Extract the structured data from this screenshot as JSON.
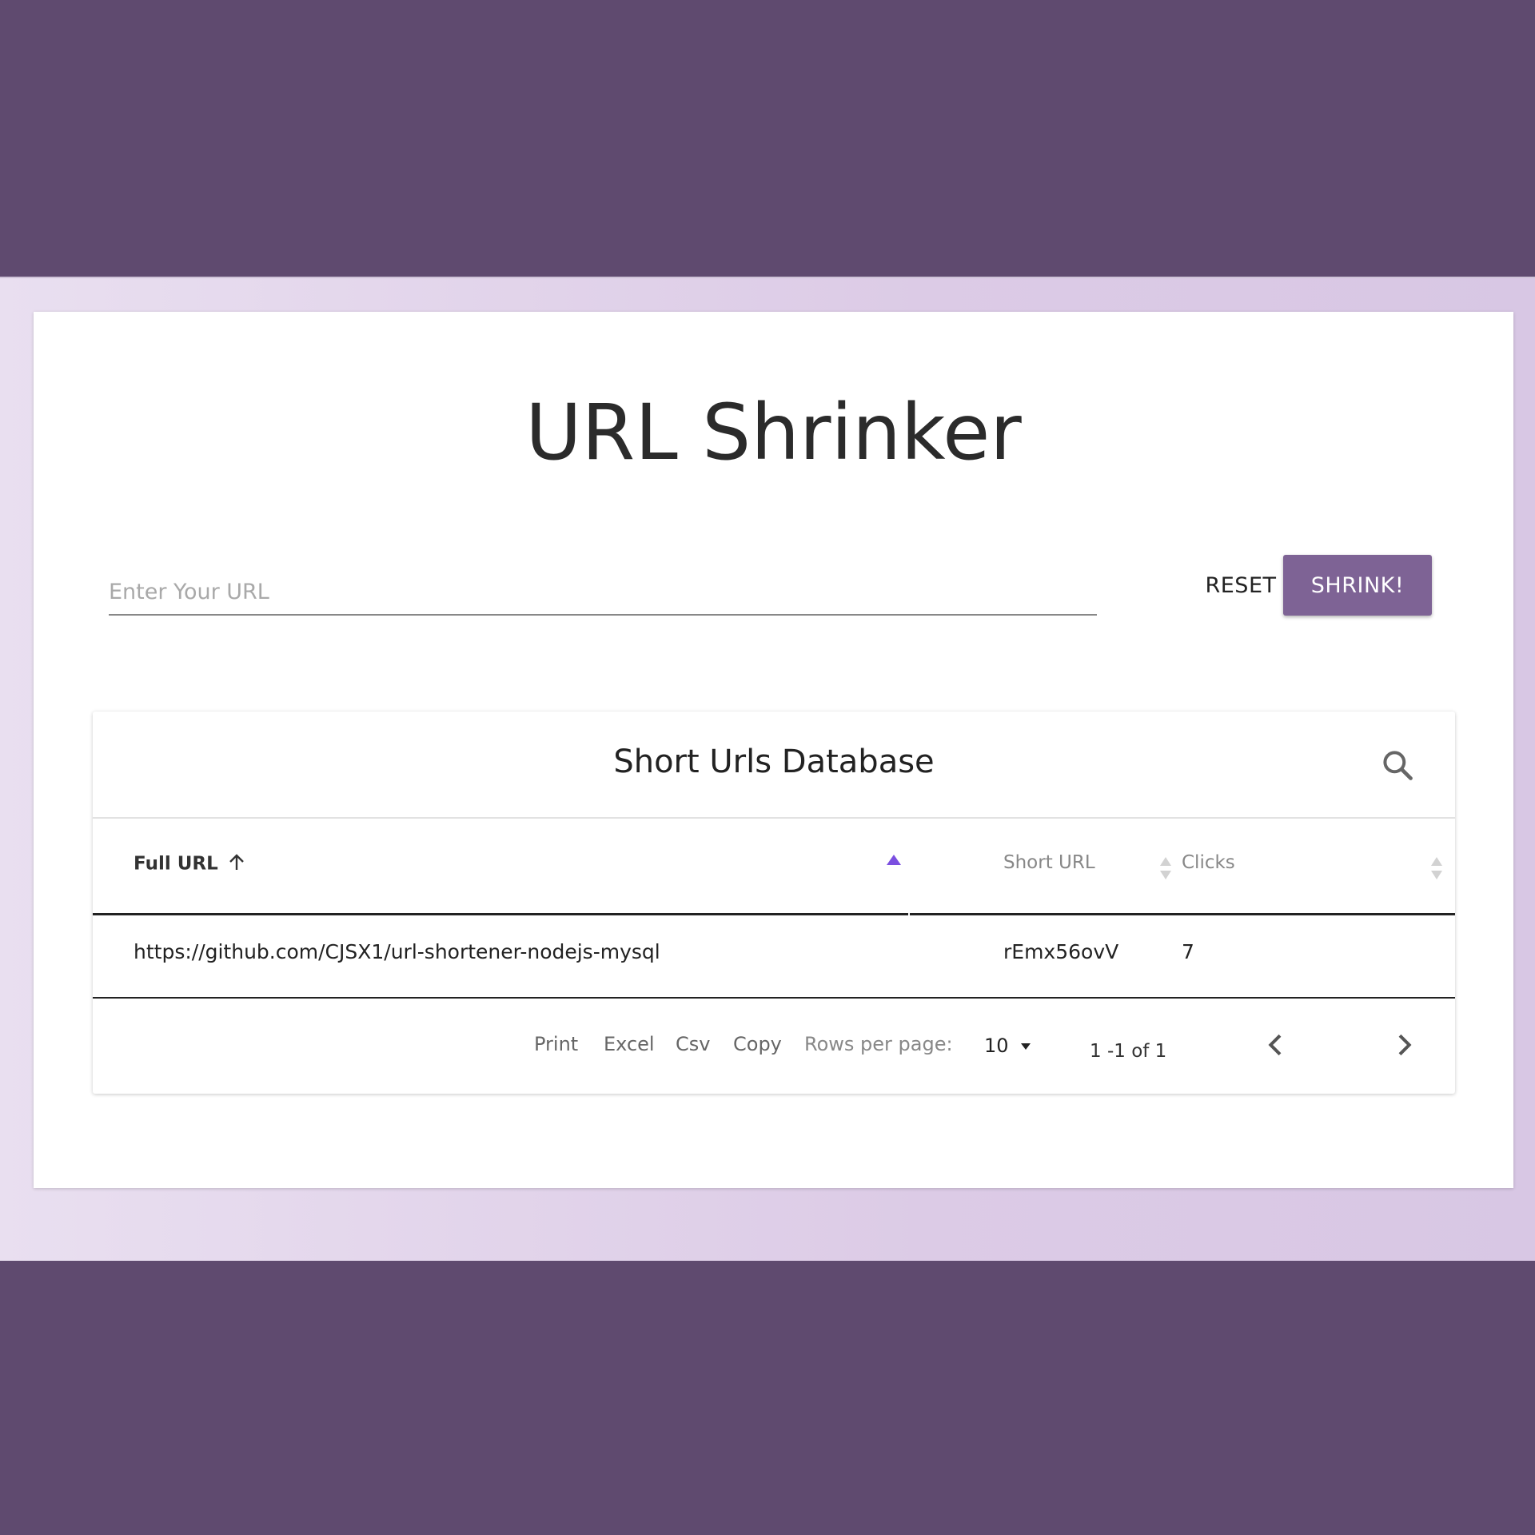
{
  "app": {
    "title": "URL Shrinker"
  },
  "form": {
    "placeholder": "Enter Your URL",
    "value": "",
    "reset_label": "RESET",
    "shrink_label": "SHRINK!"
  },
  "table": {
    "title": "Short Urls Database",
    "columns": [
      {
        "label": "Full URL",
        "sort": "ascending"
      },
      {
        "label": "Short URL",
        "sort": "none"
      },
      {
        "label": "Clicks",
        "sort": "none"
      }
    ],
    "rows": [
      {
        "full_url": "https://github.com/CJSX1/url-shortener-nodejs-mysql",
        "short_url": "rEmx56ovV",
        "clicks": "7"
      }
    ],
    "footer": {
      "print": "Print",
      "excel": "Excel",
      "csv": "Csv",
      "copy": "Copy",
      "rows_per_page_label": "Rows per page:",
      "rows_per_page_value": "10",
      "page_info": "1 -1 of 1"
    }
  },
  "colors": {
    "outer_background": "#5f4a6f",
    "accent": "#7e6395",
    "sort_active": "#7b4fe0"
  },
  "icons": [
    "search-icon",
    "arrow-up-icon",
    "sort-asc-icon",
    "sort-both-icon",
    "chevron-left-icon",
    "chevron-right-icon",
    "dropdown-caret-icon"
  ]
}
